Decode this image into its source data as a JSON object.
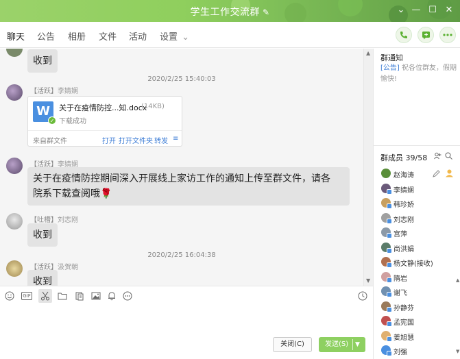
{
  "window": {
    "title": "学生工作交流群",
    "edit_icon": "pencil-icon",
    "controls": [
      "chevron-down-icon",
      "minimize-icon",
      "maximize-icon",
      "close-icon"
    ]
  },
  "tabs": [
    {
      "label": "聊天",
      "active": true
    },
    {
      "label": "公告",
      "active": false
    },
    {
      "label": "相册",
      "active": false
    },
    {
      "label": "文件",
      "active": false
    },
    {
      "label": "活动",
      "active": false
    },
    {
      "label": "设置",
      "active": false
    }
  ],
  "settings_arrow": "⌄",
  "header_actions": [
    "phone-icon",
    "add-chat-icon",
    "more-icon"
  ],
  "messages": {
    "m0_text": "收到",
    "ts1": "2020/2/25 15:40:03",
    "m1_tag": "【活跃】",
    "m1_name": "李婧娴",
    "file": {
      "name": "关于在疫情防控...知.docx",
      "size": "(14KB)",
      "status": "下载成功",
      "source": "来自群文件",
      "open": "打开",
      "open_folder": "打开文件夹",
      "forward": "转发",
      "menu_icon": "≡"
    },
    "m2_tag": "【活跃】",
    "m2_name": "李婧娴",
    "m2_line1": "关于在疫情防控期间深入开展线上家访工作的通知上传至群文件，请各",
    "m2_line2": "院系下载查阅哦🌹",
    "m3_tag": "【吐槽】",
    "m3_name": "刘志刚",
    "m3_text": "收到",
    "ts2": "2020/2/25 16:04:38",
    "m4_tag": "【活跃】",
    "m4_name": "汲贺朝",
    "m4_text": "收到"
  },
  "toolbar_icons": [
    "emoji-icon",
    "gif-icon",
    "scissors-icon",
    "folder-icon",
    "doc-icon",
    "image-icon",
    "bell-icon",
    "more-circle-icon",
    "clock-icon"
  ],
  "gif_label": "GIF",
  "buttons": {
    "close": "关闭(C)",
    "send": "发送(S)"
  },
  "right_panel": {
    "notice_title": "群通知",
    "notice_hl": "[公告]",
    "notice_text": " 祝各位群友，假期愉快!",
    "members_title": "群成员 39/58",
    "members": [
      {
        "name": "赵海涛",
        "color": "#5a8f3a"
      },
      {
        "name": "李婧娴",
        "color": "#6b5a7a"
      },
      {
        "name": "韩珍娇",
        "color": "#c8a060"
      },
      {
        "name": "刘志刚",
        "color": "#a0a0a0"
      },
      {
        "name": "宫萍",
        "color": "#8c9aa8"
      },
      {
        "name": "尚洪娟",
        "color": "#5b7c6a"
      },
      {
        "name": "杨文静(接收)",
        "color": "#b07050"
      },
      {
        "name": "隋岩",
        "color": "#d0a0a0"
      },
      {
        "name": "谢飞",
        "color": "#7090b0"
      },
      {
        "name": "孙静芬",
        "color": "#9a7a5a"
      },
      {
        "name": "孟宪国",
        "color": "#c05050"
      },
      {
        "name": "姜旭慧",
        "color": "#e0b070"
      },
      {
        "name": "刘强",
        "color": "#4a8fe0"
      }
    ]
  },
  "colors": {
    "accent": "#6bbb3a",
    "link": "#3a7bd5",
    "send_button": "#8ed061"
  }
}
